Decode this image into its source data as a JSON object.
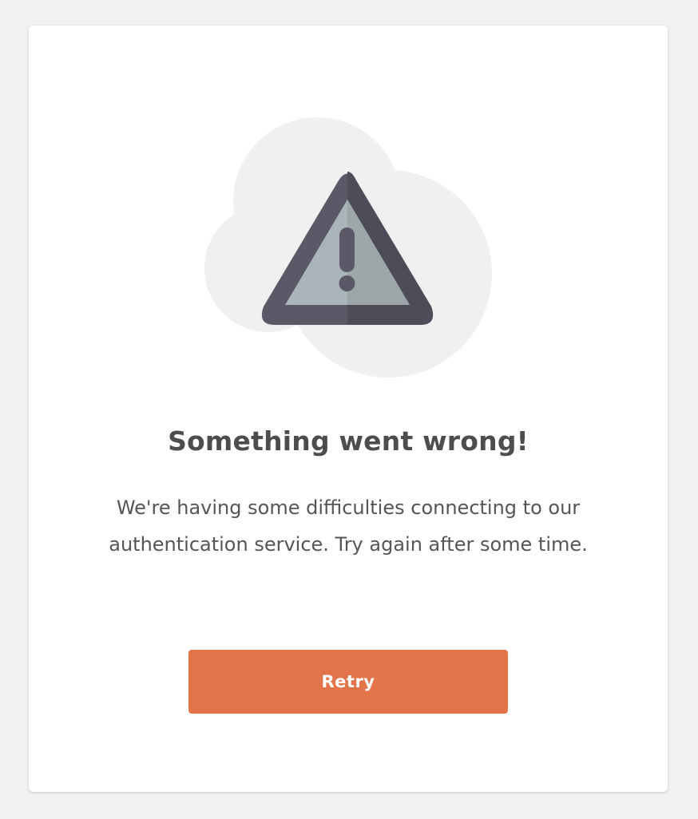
{
  "error_panel": {
    "illustration_icon": "warning-triangle-icon",
    "title": "Something went wrong!",
    "message": "We're having some difficulties connecting to our authentication service. Try again after some time.",
    "retry_label": "Retry"
  },
  "colors": {
    "page_background": "#f1f1f1",
    "card_background": "#ffffff",
    "cloud": "#f0f0f0",
    "triangle_frame": "#5b5868",
    "triangle_frame_shadow": "#4e4c58",
    "triangle_fill": "#a9b5b9",
    "triangle_fill_shadow": "#9da7aa",
    "text": "#4d4d4d",
    "button": "#e3744a",
    "button_text": "#ffffff"
  }
}
